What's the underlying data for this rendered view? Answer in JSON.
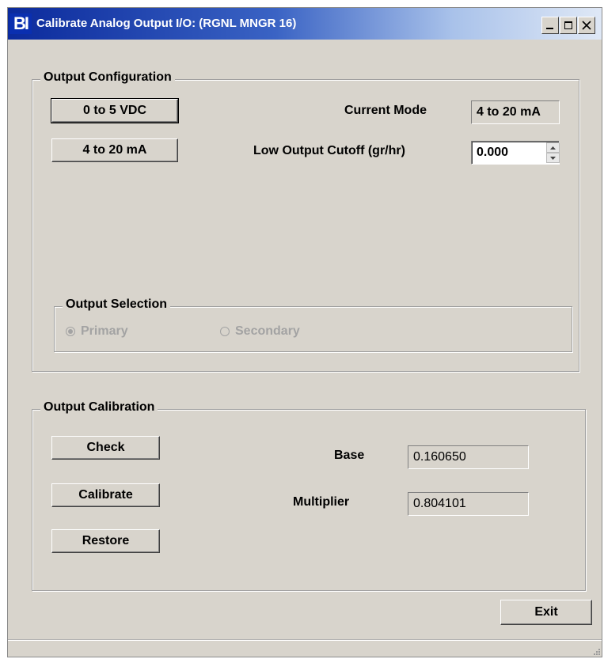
{
  "window": {
    "title": "Calibrate Analog Output I/O: (RGNL MNGR 16)",
    "icon_text": "BI",
    "controls": [
      "minimize-icon",
      "maximize-icon",
      "close-icon"
    ]
  },
  "output_configuration": {
    "legend": "Output Configuration",
    "btn_0_5": "0 to 5 VDC",
    "btn_4_20": "4 to 20 mA",
    "current_mode_label": "Current Mode",
    "current_mode_value": "4 to 20 mA",
    "low_cutoff_label": "Low Output Cutoff (gr/hr)",
    "low_cutoff_value": "0.000",
    "output_selection": {
      "legend": "Output Selection",
      "primary_label": "Primary",
      "secondary_label": "Secondary",
      "selected": "Primary",
      "enabled": false
    }
  },
  "output_calibration": {
    "legend": "Output Calibration",
    "check_label": "Check",
    "calibrate_label": "Calibrate",
    "restore_label": "Restore",
    "base_label": "Base",
    "base_value": "0.160650",
    "multiplier_label": "Multiplier",
    "multiplier_value": "0.804101"
  },
  "footer": {
    "exit_label": "Exit"
  },
  "colors": {
    "window_bg": "#d8d4cc",
    "title_gradient_start": "#0b2a9c",
    "title_gradient_end": "#dfe8f6",
    "disabled_text": "#a3a3a3"
  }
}
